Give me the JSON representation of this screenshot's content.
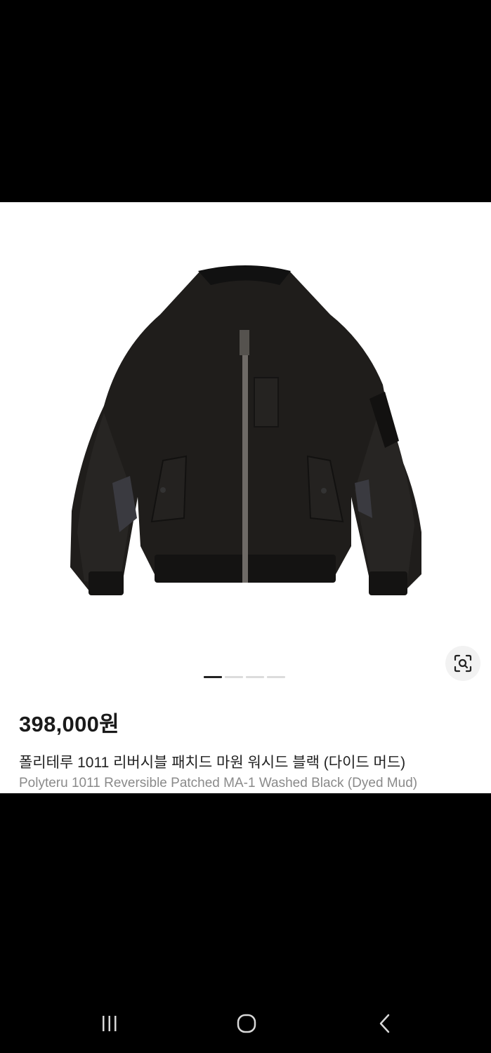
{
  "product": {
    "price": "398,000원",
    "title_ko": "폴리테루 1011 리버시블 패치드 마원 워시드 블랙 (다이드 머드)",
    "title_en": "Polyteru 1011 Reversible Patched MA-1 Washed Black (Dyed Mud)",
    "image_count": 4,
    "active_image_index": 0
  },
  "icons": {
    "lens": "visual-search-icon",
    "recents": "recent-apps-icon",
    "home": "home-icon",
    "back": "back-icon"
  },
  "colors": {
    "background": "#000000",
    "card": "#ffffff",
    "price_text": "#1a1a1a",
    "subtitle_text": "#8a8a8a",
    "indicator_active": "#222222",
    "indicator_inactive": "#dcdcdc"
  }
}
